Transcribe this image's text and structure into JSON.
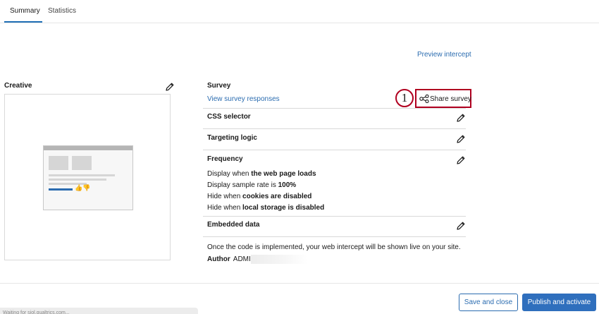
{
  "tabs": [
    {
      "label": "Summary",
      "active": true
    },
    {
      "label": "Statistics",
      "active": false
    }
  ],
  "preview_link": "Preview intercept",
  "creative": {
    "title": "Creative"
  },
  "survey": {
    "title": "Survey",
    "view_responses": "View survey responses",
    "share_label": "Share survey",
    "annotation_number": "1"
  },
  "sections": {
    "css_selector": "CSS selector",
    "targeting_logic": "Targeting logic",
    "frequency": "Frequency",
    "embedded_data": "Embedded data"
  },
  "frequency_lines": [
    {
      "prefix": "Display when ",
      "bold": "the web page loads"
    },
    {
      "prefix": "Display sample rate is ",
      "bold": "100%"
    },
    {
      "prefix": "Hide when ",
      "bold": "cookies are disabled"
    },
    {
      "prefix": "Hide when ",
      "bold": "local storage is disabled"
    }
  ],
  "note": "Once the code is implemented, your web intercept will be shown live on your site.",
  "author": {
    "label": "Author",
    "value": "ADMIN"
  },
  "buttons": {
    "save_close": "Save and close",
    "publish": "Publish and activate"
  },
  "status_bar": "Waiting for siol.qualtrics.com...",
  "icons": {
    "edit": "pencil-icon",
    "share": "share-icon"
  },
  "colors": {
    "link": "#2b6cb0",
    "primary": "#2f6fbd",
    "annotation": "#b00020"
  }
}
